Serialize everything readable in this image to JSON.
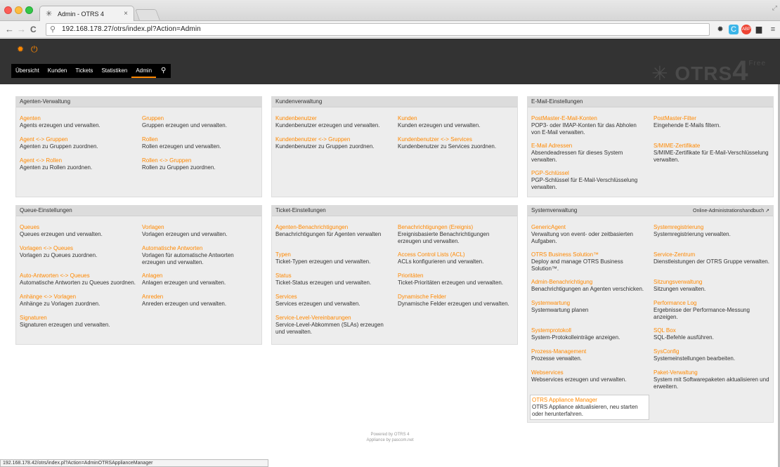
{
  "browser": {
    "tab_title": "Admin - OTRS 4",
    "tab_close": "×",
    "back": "←",
    "forward": "→",
    "reload": "C",
    "url": "192.168.178.27/otrs/index.pl?Action=Admin",
    "status_url": "192.168.178.42/otrs/index.pl?Action=AdminOTRSApplianceManager"
  },
  "header": {
    "nav": [
      "Übersicht",
      "Kunden",
      "Tickets",
      "Statistiken",
      "Admin"
    ],
    "active": "Admin",
    "logo_text": "OTRS",
    "logo_num": "4",
    "logo_edition": "Free"
  },
  "widgets": {
    "agents": {
      "title": "Agenten-Verwaltung",
      "items": [
        {
          "name": "Agenten",
          "desc": "Agents erzeugen und verwalten."
        },
        {
          "name": "Gruppen",
          "desc": "Gruppen erzeugen und verwalten."
        },
        {
          "name": "Agent <-> Gruppen",
          "desc": "Agenten zu Gruppen zuordnen."
        },
        {
          "name": "Rollen",
          "desc": "Rollen erzeugen und verwalten."
        },
        {
          "name": "Agent <-> Rollen",
          "desc": "Agenten zu Rollen zuordnen."
        },
        {
          "name": "Rollen <-> Gruppen",
          "desc": "Rollen zu Gruppen zuordnen."
        }
      ]
    },
    "customers": {
      "title": "Kundenverwaltung",
      "items": [
        {
          "name": "Kundenbenutzer",
          "desc": "Kundenbenutzer erzeugen und verwalten."
        },
        {
          "name": "Kunden",
          "desc": "Kunden erzeugen und verwalten."
        },
        {
          "name": "Kundenbenutzer <-> Gruppen",
          "desc": "Kundenbenutzer zu Gruppen zuordnen."
        },
        {
          "name": "Kundenbenutzer <-> Services",
          "desc": "Kundenbenutzer zu Services zuordnen."
        }
      ]
    },
    "email": {
      "title": "E-Mail-Einstellungen",
      "items": [
        {
          "name": "PostMaster-E-Mail-Konten",
          "desc": "POP3- oder IMAP-Konten für das Abholen von E-Mail verwalten."
        },
        {
          "name": "PostMaster-Filter",
          "desc": "Eingehende E-Mails filtern."
        },
        {
          "name": "E-Mail Adressen",
          "desc": "Absendeadressen für dieses System verwalten."
        },
        {
          "name": "S/MIME-Zertifikate",
          "desc": "S/MIME-Zertifikate für E-Mail-Verschlüsselung verwalten."
        },
        {
          "name": "PGP-Schlüssel",
          "desc": "PGP-Schlüssel für E-Mail-Verschlüsselung verwalten."
        }
      ]
    },
    "queues": {
      "title": "Queue-Einstellungen",
      "items": [
        {
          "name": "Queues",
          "desc": "Queues erzeugen und verwalten."
        },
        {
          "name": "Vorlagen",
          "desc": "Vorlagen erzeugen und verwalten."
        },
        {
          "name": "Vorlagen <-> Queues",
          "desc": "Vorlagen zu Queues zuordnen."
        },
        {
          "name": "Automatische Antworten",
          "desc": "Vorlagen für automatische Antworten erzeugen und verwalten."
        },
        {
          "name": "Auto-Antworten <-> Queues",
          "desc": "Automatische Antworten zu Queues zuordnen."
        },
        {
          "name": "Anlagen",
          "desc": "Anlagen erzeugen und verwalten."
        },
        {
          "name": "Anhänge <-> Vorlagen",
          "desc": "Anhänge zu Vorlagen zuordnen."
        },
        {
          "name": "Anreden",
          "desc": "Anreden erzeugen und verwalten."
        },
        {
          "name": "Signaturen",
          "desc": "Signaturen erzeugen und verwalten."
        }
      ]
    },
    "tickets": {
      "title": "Ticket-Einstellungen",
      "items": [
        {
          "name": "Agenten-Benachrichtigungen",
          "desc": "Benachrichtigungen für Agenten verwalten"
        },
        {
          "name": "Benachrichtigungen (Ereignis)",
          "desc": "Ereignisbasierte Benachrichtigungen erzeugen und verwalten."
        },
        {
          "name": "Typen",
          "desc": "Ticket-Typen erzeugen und verwalten."
        },
        {
          "name": "Access Control Lists (ACL)",
          "desc": "ACLs konfigurieren und verwalten."
        },
        {
          "name": "Status",
          "desc": "Ticket-Status erzeugen und verwalten."
        },
        {
          "name": "Prioritäten",
          "desc": "Ticket-Prioritäten erzeugen und verwalten."
        },
        {
          "name": "Services",
          "desc": "Services erzeugen und verwalten."
        },
        {
          "name": "Dynamische Felder",
          "desc": "Dynamische Felder erzeugen und verwalten."
        },
        {
          "name": "Service-Level-Vereinbarungen",
          "desc": "Service-Level-Abkommen (SLAs) erzeugen und verwalten."
        }
      ]
    },
    "system": {
      "title": "Systemverwaltung",
      "handbook": "Online-Administrationshandbuch",
      "items": [
        {
          "name": "GenericAgent",
          "desc": "Verwaltung von event- oder zeitbasierten Aufgaben."
        },
        {
          "name": "Systemregistrierung",
          "desc": "Systemregistrierung verwalten."
        },
        {
          "name": "OTRS Business Solution™",
          "desc": "Deploy and manage OTRS Business Solution™."
        },
        {
          "name": "Service-Zentrum",
          "desc": "Dienstleistungen der OTRS Gruppe verwalten."
        },
        {
          "name": "Admin-Benachrichtigung",
          "desc": "Benachrichtigungen an Agenten verschicken."
        },
        {
          "name": "Sitzungsverwaltung",
          "desc": "Sitzungen verwalten."
        },
        {
          "name": "Systemwartung",
          "desc": "Systemwartung planen"
        },
        {
          "name": "Performance Log",
          "desc": "Ergebnisse der Performance-Messung anzeigen."
        },
        {
          "name": "Systemprotokoll",
          "desc": "System-Protokolleinträge anzeigen."
        },
        {
          "name": "SQL Box",
          "desc": "SQL-Befehle ausführen."
        },
        {
          "name": "Prozess-Management",
          "desc": "Prozesse verwalten."
        },
        {
          "name": "SysConfig",
          "desc": "Systemeinstellungen bearbeiten."
        },
        {
          "name": "Webservices",
          "desc": "Webservices erzeugen und verwalten."
        },
        {
          "name": "Paket-Verwaltung",
          "desc": "System mit Softwarepaketen aktualisieren und erweitern."
        },
        {
          "name": "OTRS Appliance Manager",
          "desc": "OTRS Appliance aktualisieren, neu starten oder herunterfahren."
        }
      ]
    }
  },
  "footer": {
    "line1": "Powered by OTRS 4",
    "line2": "Appliance by pascom.net"
  }
}
